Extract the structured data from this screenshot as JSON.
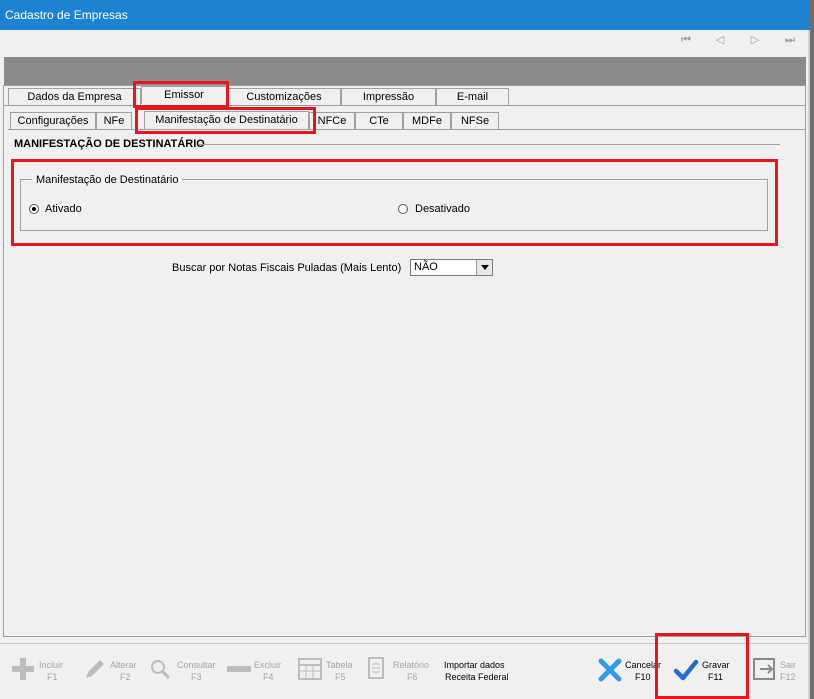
{
  "window": {
    "title": "Cadastro de Empresas"
  },
  "nav": {
    "first": "⏮",
    "prev": "◁",
    "next": "▷",
    "last": "⏭"
  },
  "tabs_main": [
    "Dados da Empresa",
    "Emissor",
    "Customizações",
    "Impressão",
    "E-mail"
  ],
  "tabs_sub": [
    "Configurações",
    "NFe",
    "Manifestação de Destinatário",
    "NFCe",
    "CTe",
    "MDFe",
    "NFSe"
  ],
  "section": {
    "title": "MANIFESTAÇÃO DE DESTINATÁRIO"
  },
  "group": {
    "legend": "Manifestação de Destinatário",
    "option_on": "Ativado",
    "option_off": "Desativado",
    "selected": "Ativado"
  },
  "search_field": {
    "label": "Buscar por Notas Fiscais Puladas (Mais Lento)",
    "value": "NÃO"
  },
  "toolbar": {
    "incluir": {
      "name": "Incluir",
      "key": "F1"
    },
    "alterar": {
      "name": "Alterar",
      "key": "F2"
    },
    "consultar": {
      "name": "Consultar",
      "key": "F3"
    },
    "excluir": {
      "name": "Excluir",
      "key": "F4"
    },
    "tabela": {
      "name": "Tabela",
      "key": "F5"
    },
    "relatorio": {
      "name": "Relatório",
      "key": "F6"
    },
    "importar": {
      "line1": "Importar dados",
      "line2": "Receita Federal"
    },
    "cancelar": {
      "name": "Cancelar",
      "key": "F10"
    },
    "gravar": {
      "name": "Gravar",
      "key": "F11"
    },
    "sair": {
      "name": "Sair",
      "key": "F12"
    }
  },
  "colors": {
    "titlebar": "#1c82d4",
    "highlight": "#e8151f",
    "accent_check": "#1f6fd1",
    "accent_x": "#2f9be8"
  }
}
